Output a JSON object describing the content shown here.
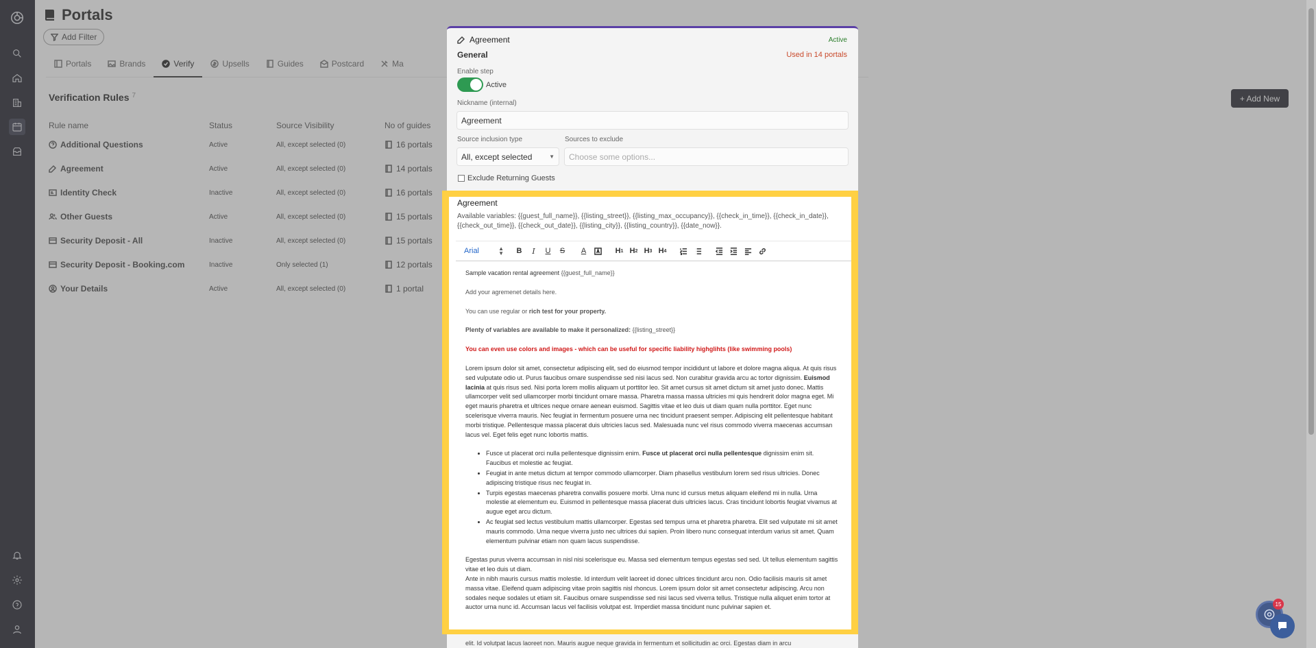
{
  "page": {
    "title": "Portals",
    "add_filter": "Add Filter",
    "tabs": [
      "Portals",
      "Brands",
      "Verify",
      "Upsells",
      "Guides",
      "Postcard",
      "Ma"
    ],
    "section_title": "Verification Rules",
    "section_count": "7",
    "add_new": "+ Add New"
  },
  "table": {
    "headers": [
      "Rule name",
      "Status",
      "Source Visibility",
      "No of guides"
    ],
    "rows": [
      {
        "name": "Additional Questions",
        "icon": "question-circle-icon",
        "status": "Active",
        "visibility": "All, except selected (0)",
        "guides": "16 portals"
      },
      {
        "name": "Agreement",
        "icon": "edit-icon",
        "status": "Active",
        "visibility": "All, except selected (0)",
        "guides": "14 portals"
      },
      {
        "name": "Identity Check",
        "icon": "id-card-icon",
        "status": "Inactive",
        "visibility": "All, except selected (0)",
        "guides": "16 portals"
      },
      {
        "name": "Other Guests",
        "icon": "users-icon",
        "status": "Active",
        "visibility": "All, except selected (0)",
        "guides": "15 portals"
      },
      {
        "name": "Security Deposit - All",
        "icon": "credit-card-icon",
        "status": "Inactive",
        "visibility": "All, except selected (0)",
        "guides": "15 portals"
      },
      {
        "name": "Security Deposit - Booking.com",
        "icon": "credit-card-icon",
        "status": "Inactive",
        "visibility": "Only selected (1)",
        "guides": "12 portals"
      },
      {
        "name": "Your Details",
        "icon": "user-circle-icon",
        "status": "Active",
        "visibility": "All, except selected (0)",
        "guides": "1 portal"
      }
    ]
  },
  "modal": {
    "title": "Agreement",
    "status": "Active",
    "general": "General",
    "used_in": "Used in 14 portals",
    "enable_step_label": "Enable step",
    "toggle_text": "Active",
    "nickname_label": "Nickname (internal)",
    "nickname_value": "Agreement",
    "source_inclusion_label": "Source inclusion type",
    "source_inclusion_value": "All, except selected",
    "sources_exclude_label": "Sources to exclude",
    "sources_exclude_placeholder": "Choose some options...",
    "exclude_returning": "Exclude Returning Guests"
  },
  "editor": {
    "title": "Agreement",
    "variables": "Available variables: {{guest_full_name}}, {{listing_street}}, {{listing_max_occupancy}}, {{check_in_time}}, {{check_in_date}}, {{check_out_time}}, {{check_out_date}}, {{listing_city}}, {{listing_country}}, {{date_now}}.",
    "font": "Arial",
    "heading_prefix": "Sample vacation rental agreement ",
    "heading_var": "{{guest_full_name}}",
    "p_details": "Add your agremenet details here.",
    "p_rich_a": "You can use regular or ",
    "p_rich_b": "rich test for your property.",
    "p_vars_a": "Plenty of variables are available to make it personalized: ",
    "p_vars_b": "{{listing_street}}",
    "p_red": "You can even use colors and images - which can be useful for specific liability highglihts (like swimming pools)",
    "lorem_a": "Lorem ipsum dolor sit amet, consectetur adipiscing elit, sed do eiusmod tempor incididunt ut labore et dolore magna aliqua. At quis risus sed vulputate odio ut. Purus faucibus ornare suspendisse sed nisi lacus sed. Non curabitur gravida arcu ac tortor dignissim. ",
    "lorem_bold": "Euismod lacinia",
    "lorem_b": " at quis risus sed. Nisi porta lorem mollis aliquam ut porttitor leo. Sit amet cursus sit amet dictum sit amet justo donec. Mattis ullamcorper velit sed ullamcorper morbi tincidunt ornare massa. Pharetra massa massa ultricies mi quis hendrerit dolor magna eget. Mi eget mauris pharetra et ultrices neque ornare aenean euismod. Sagittis vitae et leo duis ut diam quam nulla porttitor. Eget nunc scelerisque viverra mauris. Nec feugiat in fermentum posuere urna nec tincidunt praesent semper. Adipiscing elit pellentesque habitant morbi tristique. Pellentesque massa placerat duis ultricies lacus sed. Malesuada nunc vel risus commodo viverra maecenas accumsan lacus vel. Eget felis eget nunc lobortis mattis.",
    "li1_a": "Fusce ut placerat orci nulla pellentesque dignissim enim. ",
    "li1_bold": "Fusce ut placerat orci nulla pellentesque",
    "li1_b": " dignissim enim sit. Faucibus et molestie ac feugiat.",
    "li2": "Feugiat in ante metus dictum at tempor commodo ullamcorper. Diam phasellus vestibulum lorem sed risus ultricies. Donec adipiscing tristique risus nec feugiat in.",
    "li3": "Turpis egestas maecenas pharetra convallis posuere morbi. Urna nunc id cursus metus aliquam eleifend mi in nulla. Urna molestie at elementum eu. Euismod in pellentesque massa placerat duis ultricies lacus. Cras tincidunt lobortis feugiat vivamus at augue eget arcu dictum.",
    "li4": "Ac feugiat sed lectus vestibulum mattis ullamcorper. Egestas sed tempus urna et pharetra pharetra. Elit sed vulputate mi sit amet mauris commodo. Urna neque viverra justo nec ultrices dui sapien. Proin libero nunc consequat interdum varius sit amet. Quam elementum pulvinar etiam non quam lacus suspendisse.",
    "p_egestas": "Egestas purus viverra accumsan in nisl nisi scelerisque eu. Massa sed elementum tempus egestas sed sed. Ut tellus elementum sagittis vitae et leo duis ut diam.",
    "p_ante": "Ante in nibh mauris cursus mattis molestie. Id interdum velit laoreet id donec ultrices tincidunt arcu non. Odio facilisis mauris sit amet massa vitae. Eleifend quam adipiscing vitae proin sagittis nisl rhoncus. Lorem ipsum dolor sit amet consectetur adipiscing. Arcu non sodales neque sodales ut etiam sit. Faucibus ornare suspendisse sed nisi lacus sed viverra tellus. Tristique nulla aliquet enim tortor at auctor urna nunc id. Accumsan lacus vel facilisis volutpat est. Imperdiet massa tincidunt nunc pulvinar sapien et.",
    "spill": "elit. Id volutpat lacus laoreet non. Mauris augue neque gravida in fermentum et sollicitudin ac orci. Egestas diam in arcu"
  },
  "chat": {
    "badge": "15"
  }
}
